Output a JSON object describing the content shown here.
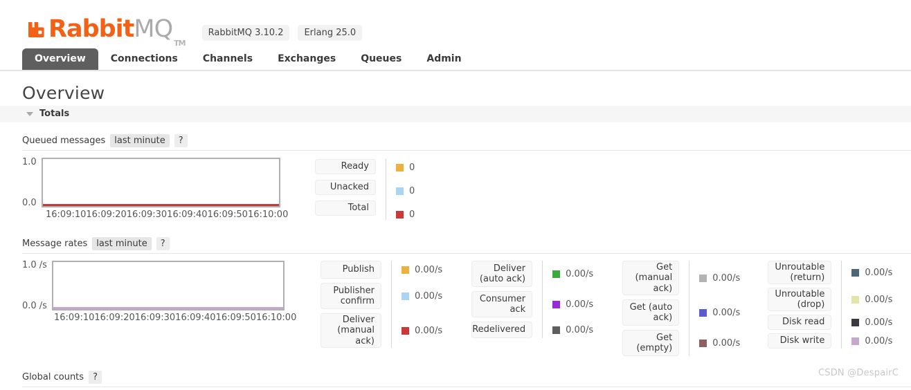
{
  "header": {
    "logo_icon": "rabbitmq-logo-icon",
    "logo_text_primary": "Rabbit",
    "logo_text_secondary": "MQ",
    "logo_trademark": "TM",
    "logo_color": "#f36117",
    "badges": [
      {
        "label": "RabbitMQ 3.10.2"
      },
      {
        "label": "Erlang 25.0"
      }
    ]
  },
  "nav": {
    "tabs": [
      {
        "label": "Overview",
        "active": true
      },
      {
        "label": "Connections",
        "active": false
      },
      {
        "label": "Channels",
        "active": false
      },
      {
        "label": "Exchanges",
        "active": false
      },
      {
        "label": "Queues",
        "active": false
      },
      {
        "label": "Admin",
        "active": false
      }
    ]
  },
  "page": {
    "title": "Overview",
    "totals_section_label": "Totals",
    "global_counts_label": "Global counts",
    "help_label": "?",
    "watermark": "CSDN @DespairC"
  },
  "queued_messages": {
    "label": "Queued messages",
    "period": "last minute",
    "help": "?",
    "legend": [
      {
        "name": "Ready",
        "value": "0",
        "color": "#edb13e"
      },
      {
        "name": "Unacked",
        "value": "0",
        "color": "#aad4f5"
      },
      {
        "name": "Total",
        "value": "0",
        "color": "#c9393a"
      }
    ]
  },
  "message_rates": {
    "label": "Message rates",
    "period": "last minute",
    "help": "?",
    "legend_columns": [
      [
        {
          "name": "Publish",
          "value": "0.00/s",
          "color": "#edb13e"
        },
        {
          "name": "Publisher confirm",
          "value": "0.00/s",
          "color": "#aad4f5"
        },
        {
          "name": "Deliver (manual ack)",
          "value": "0.00/s",
          "color": "#c9393a"
        }
      ],
      [
        {
          "name": "Deliver (auto ack)",
          "value": "0.00/s",
          "color": "#3ba93b"
        },
        {
          "name": "Consumer ack",
          "value": "0.00/s",
          "color": "#9a2ad6"
        },
        {
          "name": "Redelivered",
          "value": "0.00/s",
          "color": "#5e5e5e"
        }
      ],
      [
        {
          "name": "Get (manual ack)",
          "value": "0.00/s",
          "color": "#b3b3b3"
        },
        {
          "name": "Get (auto ack)",
          "value": "0.00/s",
          "color": "#5b5bd6"
        },
        {
          "name": "Get (empty)",
          "value": "0.00/s",
          "color": "#8f5f5f"
        }
      ],
      [
        {
          "name": "Unroutable (return)",
          "value": "0.00/s",
          "color": "#4c6878"
        },
        {
          "name": "Unroutable (drop)",
          "value": "0.00/s",
          "color": "#e4e4a8"
        },
        {
          "name": "Disk read",
          "value": "0.00/s",
          "color": "#3a3a44"
        },
        {
          "name": "Disk write",
          "value": "0.00/s",
          "color": "#c6a8cf"
        }
      ]
    ]
  },
  "chart_data": [
    {
      "type": "line",
      "title": "Queued messages",
      "subtitle": "last minute",
      "xlabel": "",
      "ylabel": "",
      "ylim": [
        0.0,
        1.0
      ],
      "yticks": [
        "1.0",
        "0.0"
      ],
      "x": [
        "16:09:10",
        "16:09:20",
        "16:09:30",
        "16:09:40",
        "16:09:50",
        "16:10:00"
      ],
      "grid": false,
      "legend_position": "right",
      "series": [
        {
          "name": "Ready",
          "color": "#edb13e",
          "values": [
            0,
            0,
            0,
            0,
            0,
            0
          ]
        },
        {
          "name": "Unacked",
          "color": "#aad4f5",
          "values": [
            0,
            0,
            0,
            0,
            0,
            0
          ]
        },
        {
          "name": "Total",
          "color": "#c9393a",
          "values": [
            0,
            0,
            0,
            0,
            0,
            0
          ]
        }
      ],
      "visible_line_color": "#c9393a"
    },
    {
      "type": "line",
      "title": "Message rates",
      "subtitle": "last minute",
      "xlabel": "",
      "ylabel": "/s",
      "ylim": [
        0.0,
        1.0
      ],
      "yticks": [
        "1.0 /s",
        "0.0 /s"
      ],
      "x": [
        "16:09:10",
        "16:09:20",
        "16:09:30",
        "16:09:40",
        "16:09:50",
        "16:10:00"
      ],
      "grid": false,
      "legend_position": "right",
      "series": [
        {
          "name": "Publish",
          "color": "#edb13e",
          "values": [
            0,
            0,
            0,
            0,
            0,
            0
          ]
        },
        {
          "name": "Publisher confirm",
          "color": "#aad4f5",
          "values": [
            0,
            0,
            0,
            0,
            0,
            0
          ]
        },
        {
          "name": "Deliver (manual ack)",
          "color": "#c9393a",
          "values": [
            0,
            0,
            0,
            0,
            0,
            0
          ]
        },
        {
          "name": "Deliver (auto ack)",
          "color": "#3ba93b",
          "values": [
            0,
            0,
            0,
            0,
            0,
            0
          ]
        },
        {
          "name": "Consumer ack",
          "color": "#9a2ad6",
          "values": [
            0,
            0,
            0,
            0,
            0,
            0
          ]
        },
        {
          "name": "Redelivered",
          "color": "#5e5e5e",
          "values": [
            0,
            0,
            0,
            0,
            0,
            0
          ]
        },
        {
          "name": "Get (manual ack)",
          "color": "#b3b3b3",
          "values": [
            0,
            0,
            0,
            0,
            0,
            0
          ]
        },
        {
          "name": "Get (auto ack)",
          "color": "#5b5bd6",
          "values": [
            0,
            0,
            0,
            0,
            0,
            0
          ]
        },
        {
          "name": "Get (empty)",
          "color": "#8f5f5f",
          "values": [
            0,
            0,
            0,
            0,
            0,
            0
          ]
        },
        {
          "name": "Unroutable (return)",
          "color": "#4c6878",
          "values": [
            0,
            0,
            0,
            0,
            0,
            0
          ]
        },
        {
          "name": "Unroutable (drop)",
          "color": "#e4e4a8",
          "values": [
            0,
            0,
            0,
            0,
            0,
            0
          ]
        },
        {
          "name": "Disk read",
          "color": "#3a3a44",
          "values": [
            0,
            0,
            0,
            0,
            0,
            0
          ]
        },
        {
          "name": "Disk write",
          "color": "#c6a8cf",
          "values": [
            0,
            0,
            0,
            0,
            0,
            0
          ]
        }
      ],
      "visible_line_color": "#c6a8cf"
    }
  ]
}
